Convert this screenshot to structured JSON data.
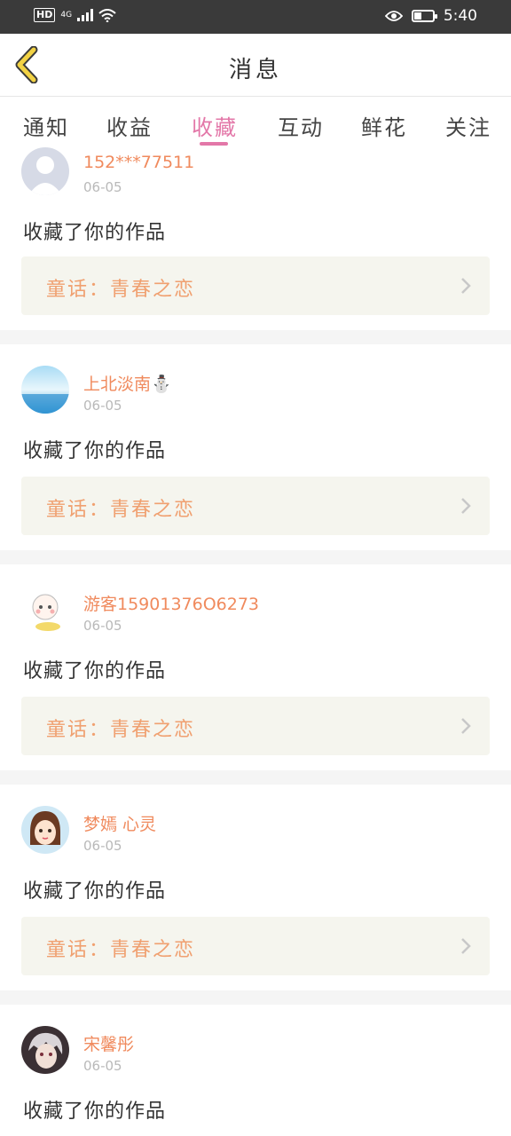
{
  "status_bar": {
    "hd": "HD",
    "network": "4G",
    "time": "5:40",
    "battery_level": 0.35
  },
  "header": {
    "title": "消息"
  },
  "tabs": [
    {
      "label": "通知"
    },
    {
      "label": "收益"
    },
    {
      "label": "收藏"
    },
    {
      "label": "互动"
    },
    {
      "label": "鲜花"
    },
    {
      "label": "关注"
    }
  ],
  "active_tab": "收藏",
  "messages": [
    {
      "username": "152***77511",
      "date": "06-05",
      "action": "收藏了你的作品",
      "work": "童话：青春之恋"
    },
    {
      "username": "上北淡南⛄",
      "date": "06-05",
      "action": "收藏了你的作品",
      "work": "童话：青春之恋"
    },
    {
      "username": "游客15901376O6273",
      "date": "06-05",
      "action": "收藏了你的作品",
      "work": "童话：青春之恋"
    },
    {
      "username": "梦嫣 心灵",
      "date": "06-05",
      "action": "收藏了你的作品",
      "work": "童话：青春之恋"
    },
    {
      "username": "宋馨彤",
      "date": "06-05",
      "action": "收藏了你的作品",
      "work": ""
    }
  ],
  "colors": {
    "accent": "#e377a8",
    "username": "#f08a5d",
    "work_title": "#f0a070",
    "card_bg": "#f5f5ee",
    "status_bar": "#3a3a3a",
    "back_icon": "#f2d244"
  }
}
